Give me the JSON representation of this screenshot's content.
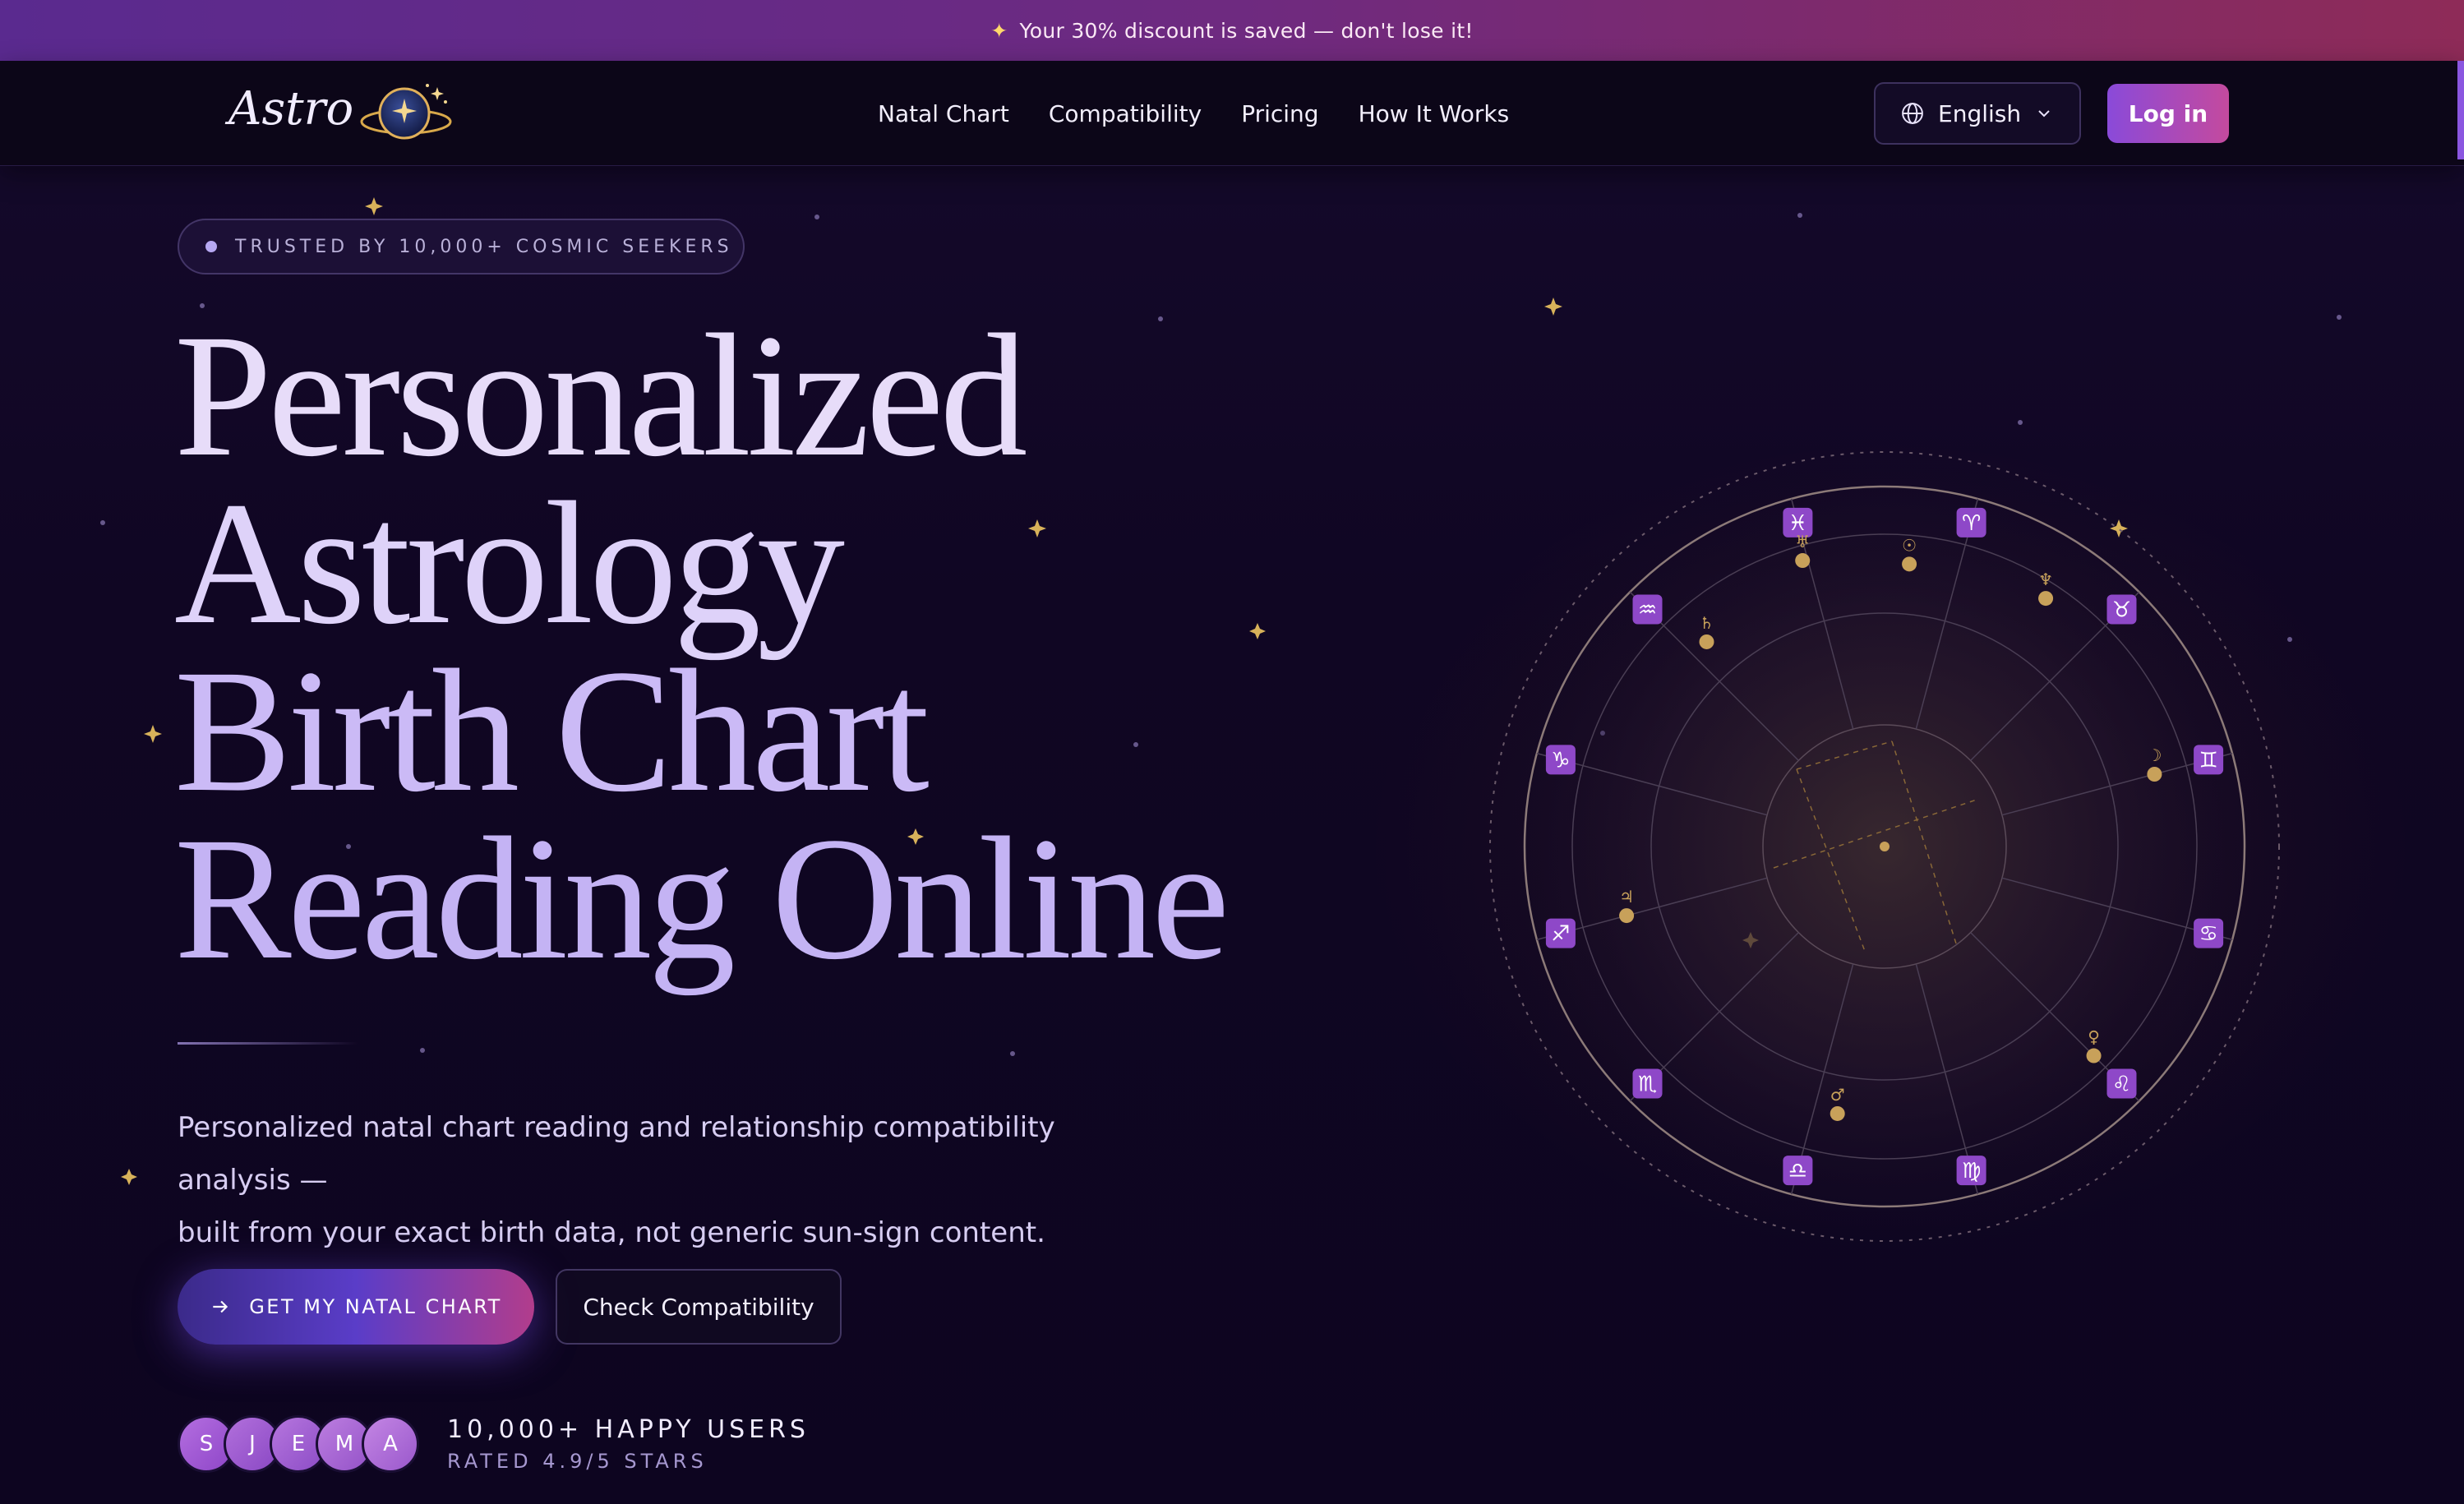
{
  "promo": {
    "icon": "sparkles-icon",
    "text": "Your 30% discount is saved — don't lose it!"
  },
  "header": {
    "logo_text": "Astro",
    "nav": [
      "Natal Chart",
      "Compatibility",
      "Pricing",
      "How It Works"
    ],
    "language": "English",
    "login": "Log in"
  },
  "hero": {
    "badge": "TRUSTED BY 10,000+ COSMIC SEEKERS",
    "headline": [
      "Personalized",
      "Astrology",
      "Birth Chart",
      "Reading Online"
    ],
    "subtitle_line1": "Personalized natal chart reading and relationship compatibility analysis —",
    "subtitle_line2": "built from your exact birth data, not generic sun-sign content.",
    "cta_primary": "GET MY NATAL CHART",
    "cta_secondary": "Check Compatibility"
  },
  "social_proof": {
    "avatars": [
      "S",
      "J",
      "E",
      "M",
      "A"
    ],
    "title": "10,000+ HAPPY USERS",
    "rating": "RATED 4.9/5 STARS"
  },
  "zodiac_wheel": {
    "signs": [
      "♈",
      "♉",
      "♊",
      "♋",
      "♌",
      "♍",
      "♎",
      "♏",
      "♐",
      "♑",
      "♒",
      "♓"
    ],
    "planets": [
      "☉",
      "♆",
      "☽",
      "♀",
      "♂",
      "♃",
      "♄",
      "♅"
    ]
  },
  "colors": {
    "background": "#0e0620",
    "accent_purple": "#8a4ad9",
    "accent_pink": "#c44a9e",
    "gold": "#c8a15a",
    "sign_tile": "#8e48c8"
  }
}
